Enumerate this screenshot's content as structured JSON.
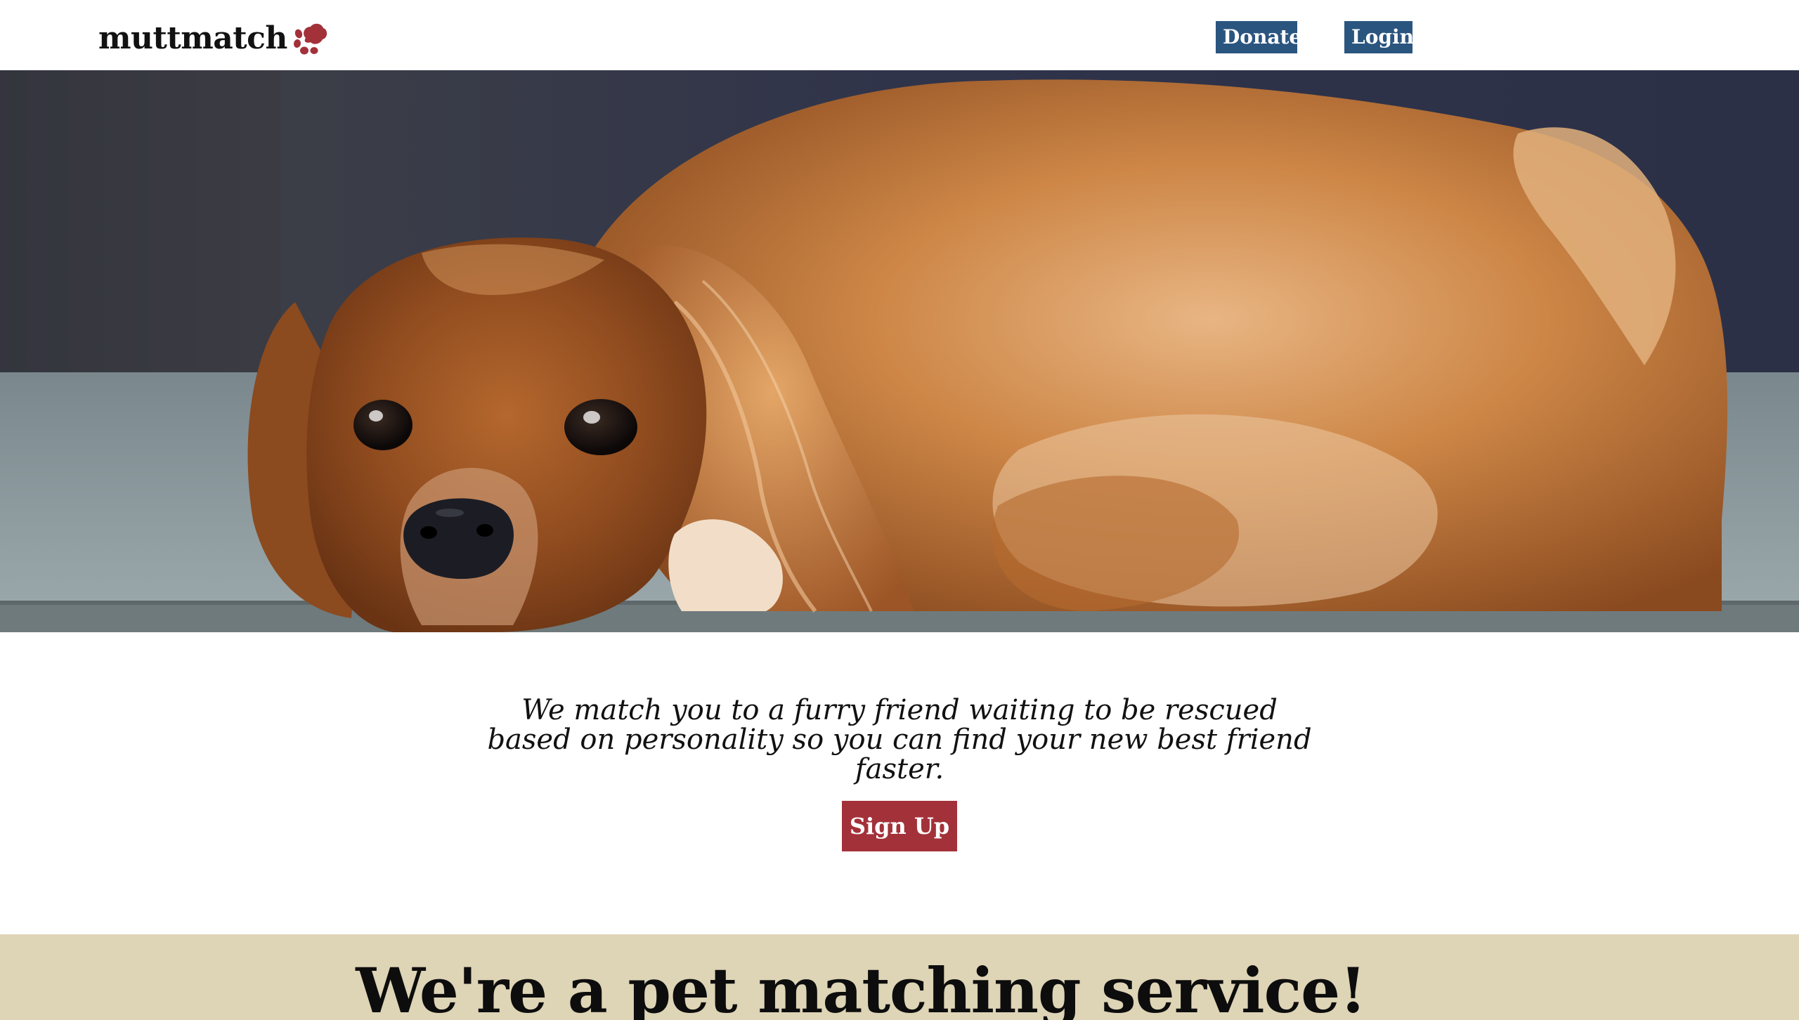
{
  "brand": {
    "name": "muttmatch",
    "icon": "paw-icon",
    "accent_color": "#a3313a"
  },
  "nav": {
    "donate_label": "Donate",
    "login_label": "Login",
    "button_color": "#2a557f"
  },
  "hero": {
    "image": "dog-photo"
  },
  "intro": {
    "tagline": "We match you to a furry friend waiting to be rescued based on personality so you can find your new best friend faster.",
    "signup_label": "Sign Up"
  },
  "section": {
    "heading": "We're a pet matching service!",
    "background_color": "#ded4b6"
  }
}
